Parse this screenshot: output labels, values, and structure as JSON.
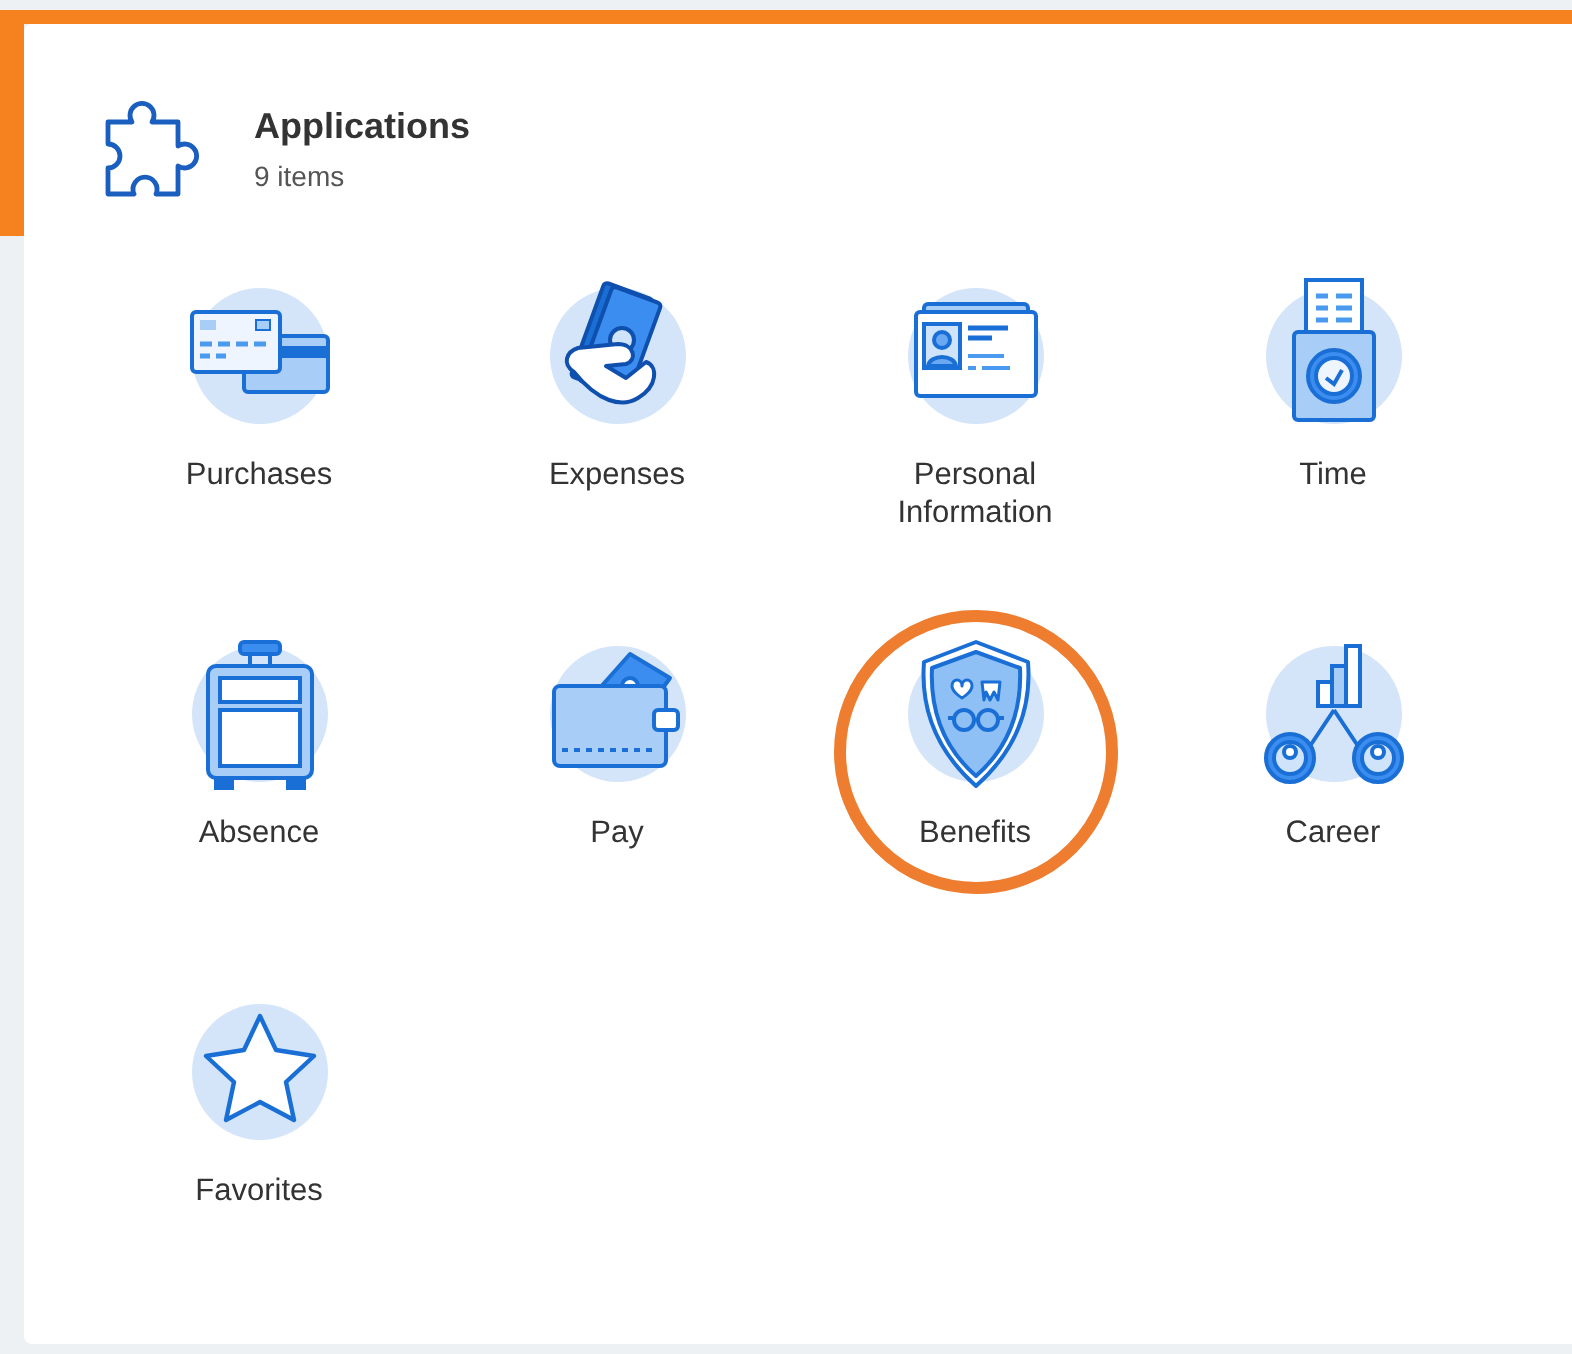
{
  "header": {
    "title": "Applications",
    "count": "9 items"
  },
  "apps": [
    {
      "label": "Purchases",
      "kind": "card",
      "highlighted": false
    },
    {
      "label": "Expenses",
      "kind": "cash",
      "highlighted": false
    },
    {
      "label": "Personal\nInformation",
      "kind": "id",
      "highlighted": false
    },
    {
      "label": "Time",
      "kind": "clock",
      "highlighted": false
    },
    {
      "label": "Absence",
      "kind": "suitcase",
      "highlighted": false
    },
    {
      "label": "Pay",
      "kind": "wallet",
      "highlighted": false
    },
    {
      "label": "Benefits",
      "kind": "shield",
      "highlighted": true
    },
    {
      "label": "Career",
      "kind": "career",
      "highlighted": false
    },
    {
      "label": "Favorites",
      "kind": "star",
      "highlighted": false
    }
  ]
}
